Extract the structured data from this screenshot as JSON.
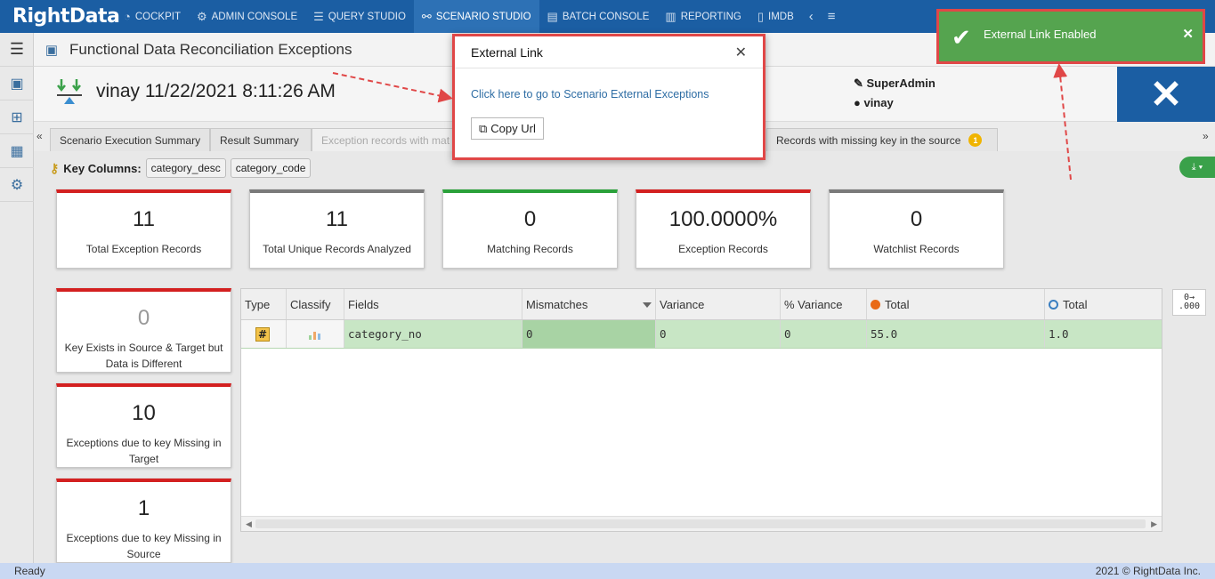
{
  "nav": {
    "logo": "RightData",
    "items": [
      {
        "label": "COCKPIT",
        "icon": "gauge-icon",
        "active": false
      },
      {
        "label": "ADMIN CONSOLE",
        "icon": "gear-icon",
        "active": false
      },
      {
        "label": "QUERY STUDIO",
        "icon": "database-icon",
        "active": false
      },
      {
        "label": "SCENARIO STUDIO",
        "icon": "network-icon",
        "active": true
      },
      {
        "label": "BATCH CONSOLE",
        "icon": "batch-icon",
        "active": false
      },
      {
        "label": "REPORTING",
        "icon": "report-icon",
        "active": false
      },
      {
        "label": "IMDB",
        "icon": "columns-icon",
        "active": false
      }
    ]
  },
  "page": {
    "title": "Functional Data Reconciliation Exceptions",
    "header_title": "vinay 11/22/2021 8:11:26 AM",
    "role": "SuperAdmin",
    "user": "vinay"
  },
  "tabs": [
    {
      "label": "Scenario Execution Summary"
    },
    {
      "label": "Result Summary"
    },
    {
      "label": "Exception records with mat"
    },
    {
      "label": "Records with missing key in the source",
      "badge": "1"
    }
  ],
  "key_columns": {
    "label": "Key Columns:",
    "values": [
      "category_desc",
      "category_code"
    ]
  },
  "cards": [
    {
      "value": "11",
      "label": "Total Exception Records",
      "accent": "#d32020"
    },
    {
      "value": "11",
      "label": "Total Unique Records Analyzed",
      "accent": "#7a7a7a"
    },
    {
      "value": "0",
      "label": "Matching Records",
      "accent": "#2aa13a"
    },
    {
      "value": "100.0000%",
      "label": "Exception Records",
      "accent": "#d32020"
    },
    {
      "value": "0",
      "label": "Watchlist Records",
      "accent": "#7a7a7a"
    }
  ],
  "side_cards": [
    {
      "value": "0",
      "label": "Key Exists in Source & Target but Data is Different"
    },
    {
      "value": "10",
      "label": "Exceptions due to key Missing in Target"
    },
    {
      "value": "1",
      "label": "Exceptions due to key Missing in Source"
    }
  ],
  "grid": {
    "headers": [
      "Type",
      "Classify",
      "Fields",
      "Mismatches",
      "Variance",
      "% Variance",
      "Total",
      "Total"
    ],
    "rows": [
      {
        "type": "#",
        "fields": "category_no",
        "mismatches": "0",
        "variance": "0",
        "pct_variance": "0",
        "total_a": "55.0",
        "total_b": "1.0"
      }
    ]
  },
  "format_button": "0→\n.000",
  "status": {
    "left": "Ready",
    "right": "2021 © RightData Inc."
  },
  "modal": {
    "title": "External Link",
    "link_text": "Click here to go to Scenario External Exceptions",
    "copy_label": "Copy Url"
  },
  "toast": {
    "message": "External Link Enabled",
    "color": "#55a44f"
  }
}
